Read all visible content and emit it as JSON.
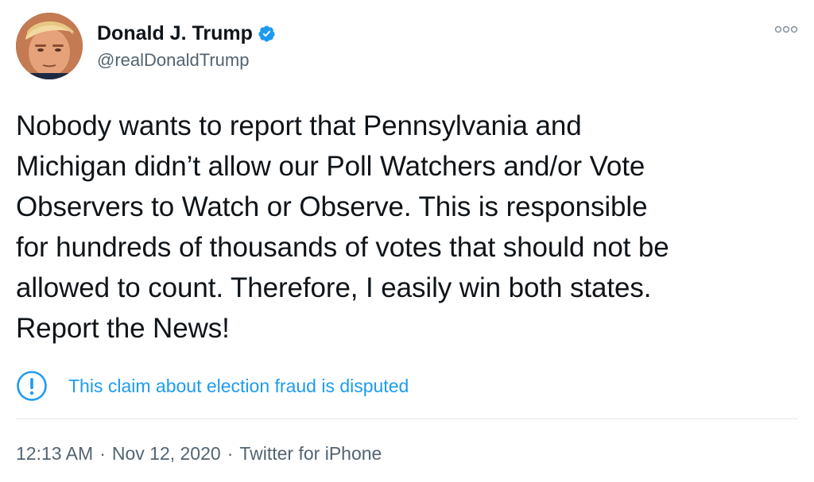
{
  "author": {
    "display_name": "Donald J. Trump",
    "handle": "@realDonaldTrump",
    "avatar_icon": "profile-photo",
    "verified_icon": "verified-badge-icon",
    "verified_color": "#1d9bf0"
  },
  "menu_icon": "more-options-icon",
  "tweet": {
    "lines": [
      "Nobody wants to report that Pennsylvania and",
      "Michigan didn’t allow our Poll Watchers and/or Vote",
      "Observers to Watch or Observe. This is responsible",
      "for hundreds of thousands of votes that should not be",
      "allowed to count. Therefore, I easily win both states.",
      "Report the News!"
    ]
  },
  "notice": {
    "icon": "exclamation-circle-icon",
    "label": "This claim about election fraud is disputed",
    "color": "#1d9bf0"
  },
  "meta": {
    "time": "12:13 AM",
    "separator": "·",
    "date": "Nov 12, 2020",
    "source": "Twitter for iPhone"
  }
}
